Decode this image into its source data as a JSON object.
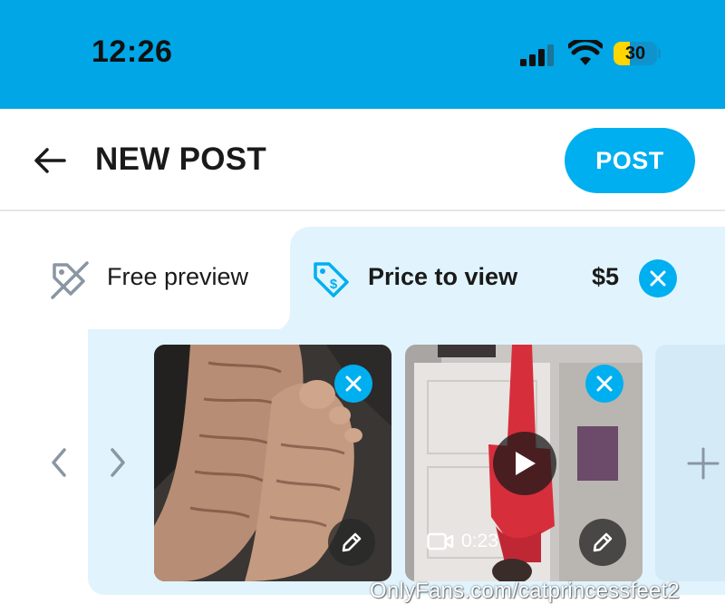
{
  "status_bar": {
    "time": "12:26",
    "battery": "30",
    "icons": [
      "signal-icon",
      "wifi-icon",
      "battery-icon"
    ]
  },
  "header": {
    "title": "NEW POST",
    "post_label": "POST",
    "back_icon": "arrow-left-icon"
  },
  "tabs": {
    "free": {
      "label": "Free preview",
      "icon": "tag-slash-icon"
    },
    "price": {
      "label": "Price to view",
      "value": "$5",
      "icon": "price-tag-icon"
    }
  },
  "media": {
    "items": [
      {
        "type": "photo"
      },
      {
        "type": "video",
        "duration": "0:23"
      }
    ],
    "add_icon": "plus-icon"
  },
  "watermark": "OnlyFans.com/catprincessfeet2",
  "colors": {
    "status_bar": "#00a6e6",
    "accent": "#00aff0",
    "panel": "#e1f4fd"
  }
}
